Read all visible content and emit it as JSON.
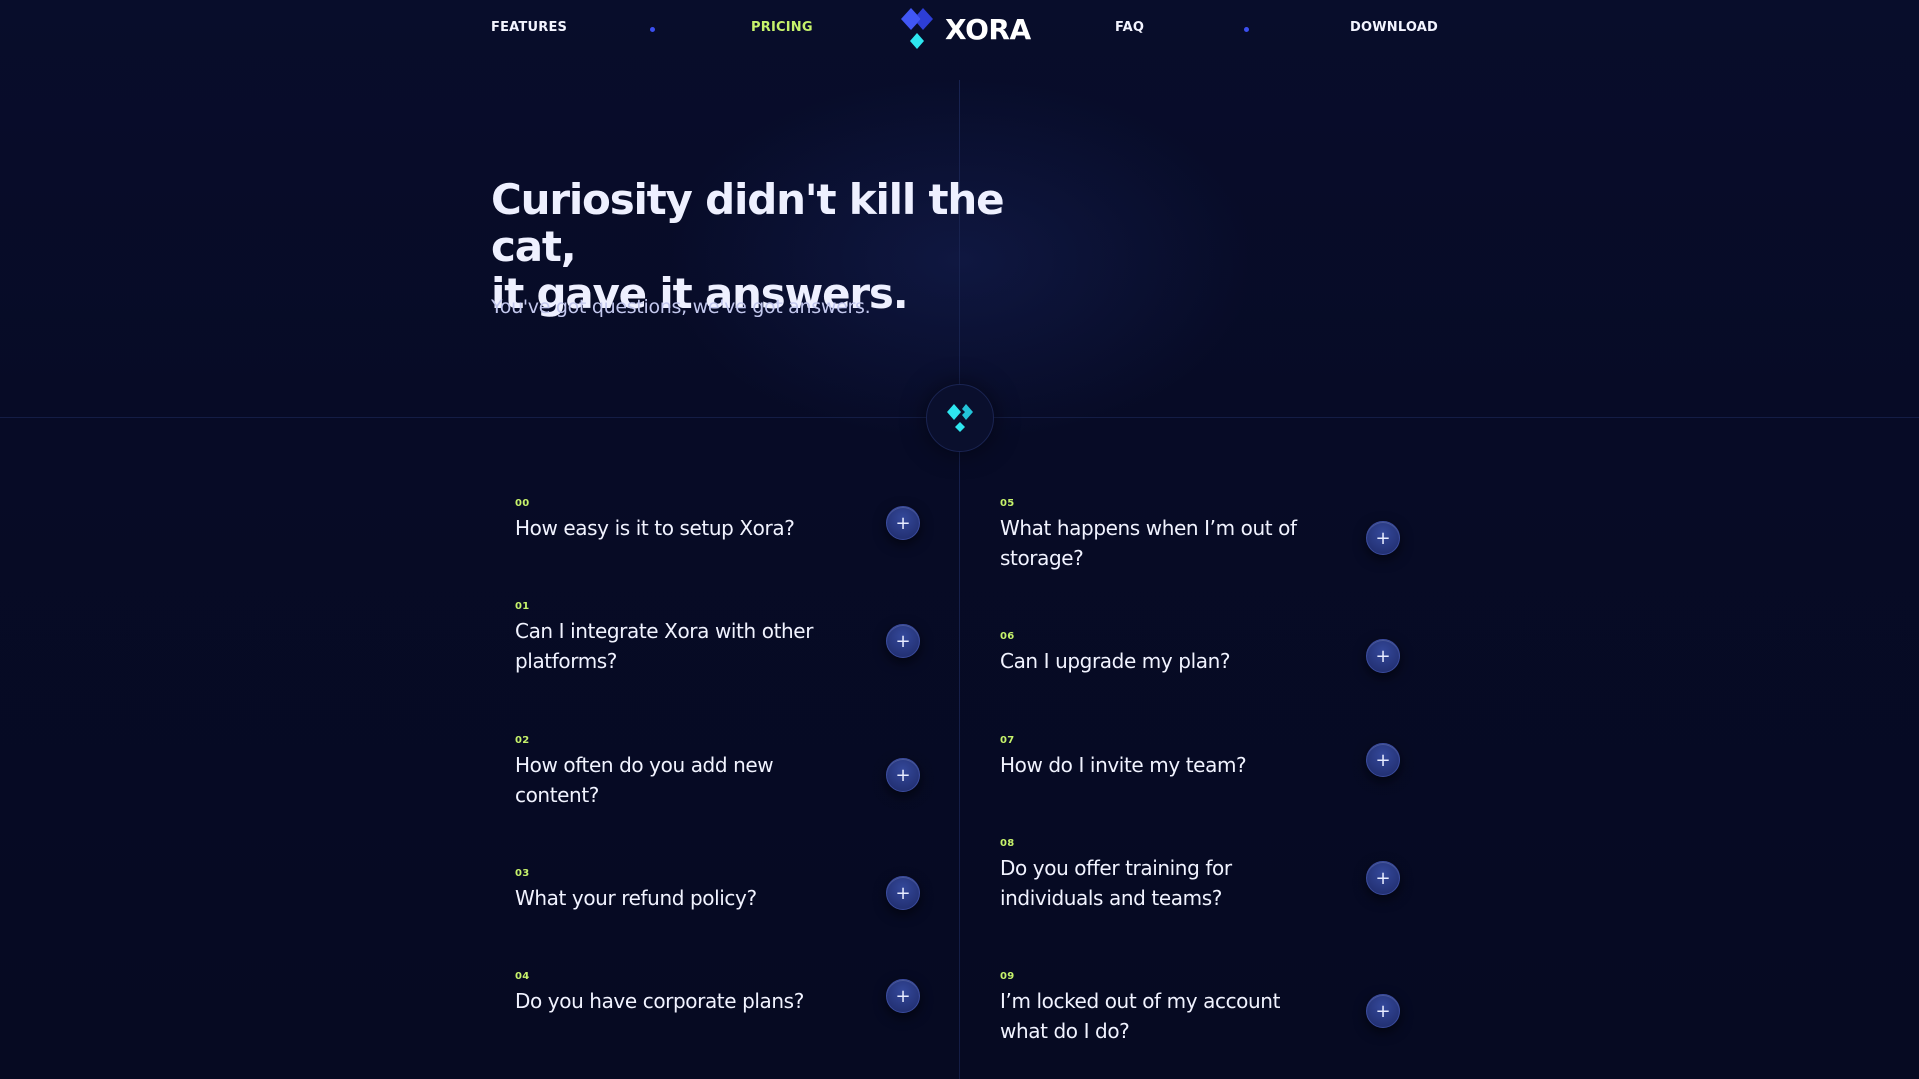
{
  "nav": {
    "left": [
      {
        "label": "FEATURES",
        "active": false
      },
      {
        "label": "PRICING",
        "active": true
      }
    ],
    "right": [
      {
        "label": "FAQ",
        "active": false
      },
      {
        "label": "DOWNLOAD",
        "active": false
      }
    ],
    "logo_text": "XORA"
  },
  "hero": {
    "title_line1": "Curiosity didn't kill the cat,",
    "title_line2": "it gave it answers.",
    "subtitle": "You've got questions, we've got answers."
  },
  "faq": {
    "left": [
      {
        "num": "00",
        "question": "How easy is it to setup Xora?"
      },
      {
        "num": "01",
        "question": "Can I integrate Xora with other platforms?"
      },
      {
        "num": "02",
        "question": "How often do you add new content?"
      },
      {
        "num": "03",
        "question": "What your refund policy?"
      },
      {
        "num": "04",
        "question": "Do you have corporate plans?"
      }
    ],
    "right": [
      {
        "num": "05",
        "question": "What happens when I’m out of storage?"
      },
      {
        "num": "06",
        "question": "Can I upgrade my plan?"
      },
      {
        "num": "07",
        "question": "How do I invite my team?"
      },
      {
        "num": "08",
        "question": "Do you offer training for individuals and teams?"
      },
      {
        "num": "09",
        "question": "I’m locked out of my account what do I do?"
      }
    ],
    "toggle_symbol": "+"
  },
  "colors": {
    "background": "#070b24",
    "accent_green": "#c6f26b",
    "accent_blue": "#3b4ff0",
    "accent_cyan": "#2ee6f0"
  },
  "icons": {
    "logo": "xora-diamond-logo-icon",
    "badge": "xora-diamond-badge-icon",
    "toggle": "plus-icon",
    "separator": "dot-icon"
  }
}
